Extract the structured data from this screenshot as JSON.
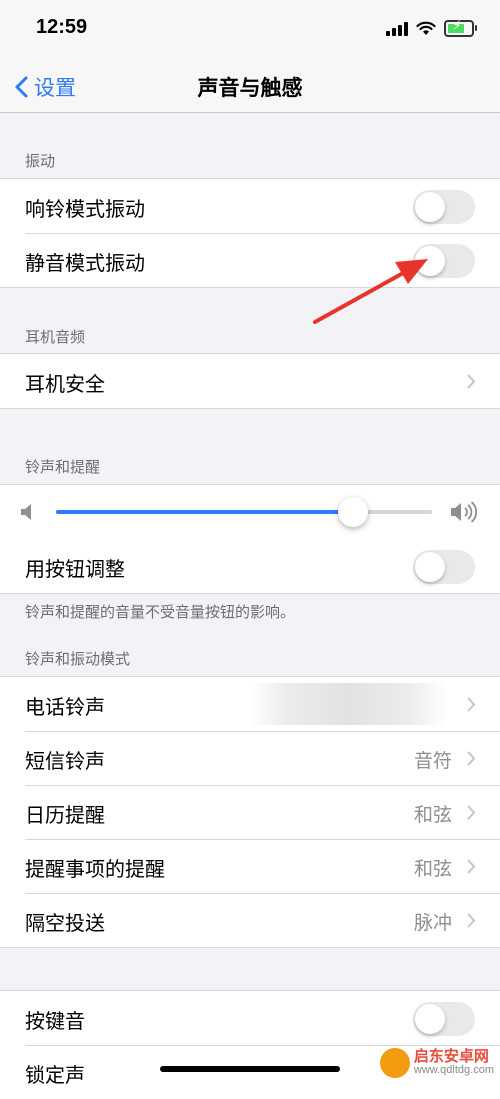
{
  "status": {
    "time": "12:59"
  },
  "nav": {
    "back_label": "设置",
    "title": "声音与触感"
  },
  "vibration": {
    "header": "振动",
    "ring_vibrate": "响铃模式振动",
    "silent_vibrate": "静音模式振动"
  },
  "headphone": {
    "header": "耳机音频",
    "safety": "耳机安全"
  },
  "ringer": {
    "header": "铃声和提醒",
    "volume_level": 0.79,
    "change_with_buttons": "用按钮调整",
    "note": "铃声和提醒的音量不受音量按钮的影响。"
  },
  "patterns": {
    "header": "铃声和振动模式",
    "rows": [
      {
        "label": "电话铃声",
        "value": ""
      },
      {
        "label": "短信铃声",
        "value": "音符"
      },
      {
        "label": "日历提醒",
        "value": "和弦"
      },
      {
        "label": "提醒事项的提醒",
        "value": "和弦"
      },
      {
        "label": "隔空投送",
        "value": "脉冲"
      }
    ]
  },
  "system": {
    "keyboard_clicks": "按键音",
    "lock_sound": "锁定声"
  },
  "watermark": {
    "name": "启东安卓网",
    "url": "www.qdltdg.com"
  },
  "colors": {
    "accent": "#2f7bf6",
    "arrow": "#e8342b",
    "toggle_off": "#e9e9eb"
  }
}
